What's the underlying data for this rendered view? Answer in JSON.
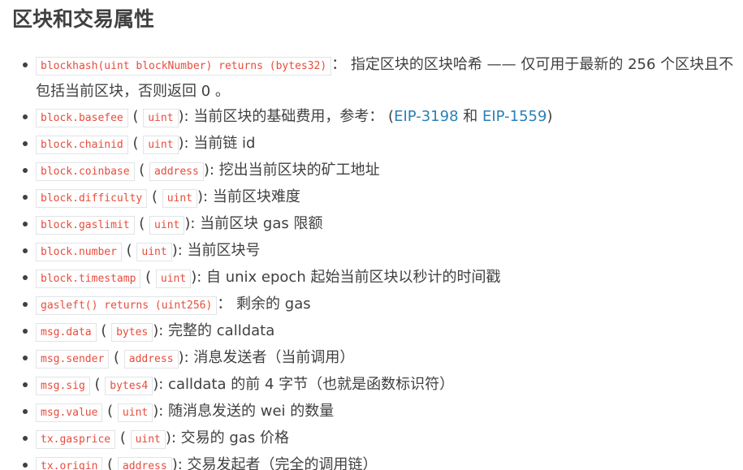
{
  "heading": "区块和交易属性",
  "items": [
    {
      "code": "blockhash(uint blockNumber) returns (bytes32)",
      "desc": "：  指定区块的区块哈希 —— 仅可用于最新的 256 个区块且不包括当前区块，否则返回 0 。"
    },
    {
      "code": "block.basefee",
      "type": "uint",
      "desc": "): 当前区块的基础费用，参考：  (",
      "link1": "EIP-3198",
      "and": " 和 ",
      "link2": "EIP-1559",
      "close": ")"
    },
    {
      "code": "block.chainid",
      "type": "uint",
      "desc": "): 当前链 id"
    },
    {
      "code": "block.coinbase",
      "type": "address",
      "desc": "): 挖出当前区块的矿工地址"
    },
    {
      "code": "block.difficulty",
      "type": "uint",
      "desc": "): 当前区块难度"
    },
    {
      "code": "block.gaslimit",
      "type": "uint",
      "desc": "): 当前区块 gas 限额"
    },
    {
      "code": "block.number",
      "type": "uint",
      "desc": "): 当前区块号"
    },
    {
      "code": "block.timestamp",
      "type": "uint",
      "desc": "): 自 unix epoch 起始当前区块以秒计的时间戳"
    },
    {
      "code": "gasleft() returns (uint256)",
      "desc": "：  剩余的 gas"
    },
    {
      "code": "msg.data",
      "type": "bytes",
      "desc": "): 完整的 calldata"
    },
    {
      "code": "msg.sender",
      "type": "address",
      "desc": "): 消息发送者（当前调用）"
    },
    {
      "code": "msg.sig",
      "type": "bytes4",
      "desc": "): calldata 的前 4 字节（也就是函数标识符）"
    },
    {
      "code": "msg.value",
      "type": "uint",
      "desc": "): 随消息发送的 wei 的数量"
    },
    {
      "code": "tx.gasprice",
      "type": "uint",
      "desc": "): 交易的 gas 价格"
    },
    {
      "code": "tx.origin",
      "type": "address",
      "desc": "): 交易发起者（完全的调用链）"
    }
  ],
  "open_paren": " ( "
}
